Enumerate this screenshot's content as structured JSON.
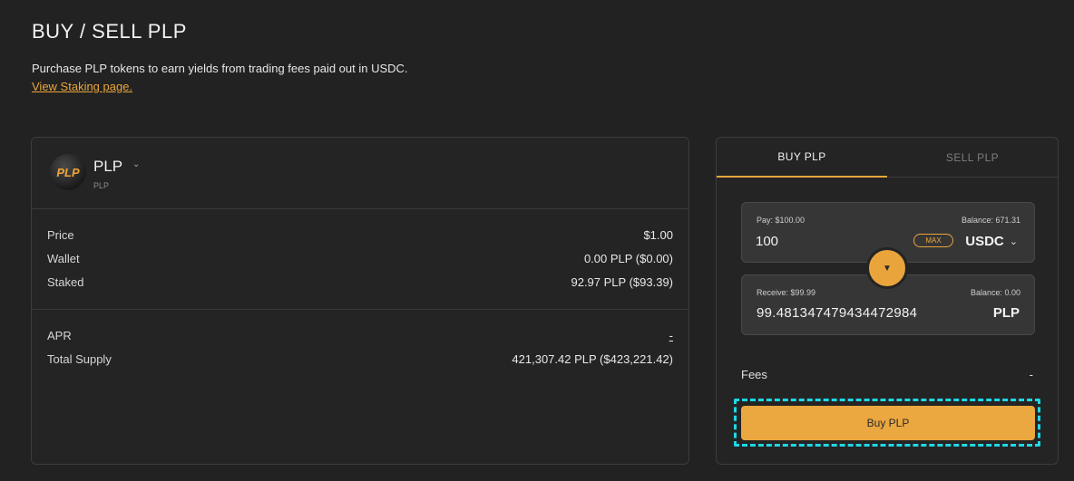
{
  "header": {
    "title": "BUY / SELL PLP",
    "description": "Purchase PLP tokens to earn yields from trading fees paid out in USDC.",
    "staking_link": "View Staking page."
  },
  "token": {
    "logo_text": "PLP",
    "name": "PLP",
    "symbol": "PLP",
    "chevron_icon": "chevron-down-icon"
  },
  "stats": {
    "price_label": "Price",
    "price_value": "$1.00",
    "wallet_label": "Wallet",
    "wallet_value": "0.00 PLP ($0.00)",
    "staked_label": "Staked",
    "staked_value": "92.97 PLP ($93.39)",
    "apr_label": "APR",
    "apr_value": "-",
    "supply_label": "Total Supply",
    "supply_value": "421,307.42 PLP ($423,221.42)"
  },
  "trade": {
    "tabs": [
      {
        "label": "BUY PLP",
        "active": true
      },
      {
        "label": "SELL PLP",
        "active": false
      }
    ],
    "pay": {
      "label": "Pay: $100.00",
      "balance": "Balance: 671.31",
      "amount": "100",
      "max_label": "MAX",
      "token": "USDC"
    },
    "receive": {
      "label": "Receive: $99.99",
      "balance": "Balance: 0.00",
      "amount": "99.481347479434472984",
      "token": "PLP"
    },
    "swap_icon": "arrow-down-icon",
    "fees_label": "Fees",
    "fees_value": "-",
    "buy_button": "Buy PLP"
  },
  "colors": {
    "accent": "#e9a53c",
    "background": "#222222",
    "card": "#242424",
    "field": "#363636",
    "focus_outline": "#1ed8e6"
  }
}
